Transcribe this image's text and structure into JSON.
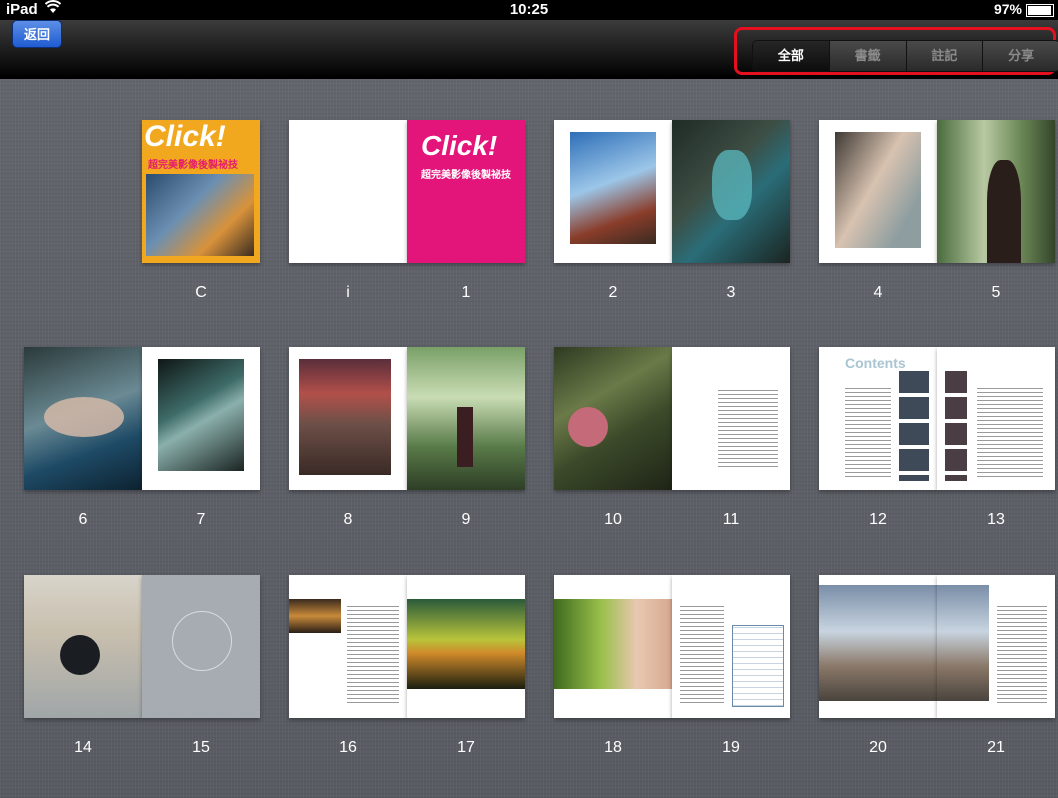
{
  "status_bar": {
    "carrier": "iPad",
    "wifi_icon": "wifi-icon",
    "time": "10:25",
    "battery": "97%"
  },
  "nav": {
    "back_label": "返回"
  },
  "segments": [
    "全部",
    "書籤",
    "註記",
    "分享"
  ],
  "active_segment": "全部",
  "cover": {
    "title": "Click!",
    "subtitle": "超完美影像後製祕技"
  },
  "pages": {
    "row1": [
      "C",
      "i",
      "1",
      "2",
      "3",
      "4",
      "5"
    ],
    "row2": [
      "6",
      "7",
      "8",
      "9",
      "10",
      "11",
      "12",
      "13"
    ],
    "row3": [
      "14",
      "15",
      "16",
      "17",
      "18",
      "19",
      "20",
      "21"
    ]
  },
  "contents_title": "Contents"
}
